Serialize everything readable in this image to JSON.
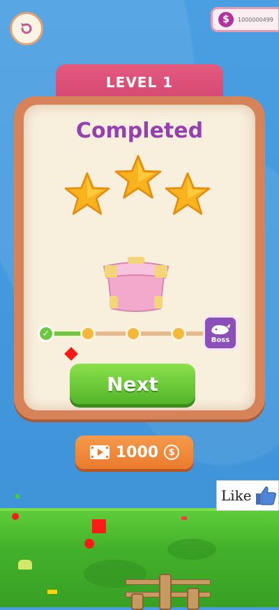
{
  "hud": {
    "restart_icon": "restart-icon",
    "coins": "1000000499",
    "coin_symbol": "$"
  },
  "level": {
    "title": "LEVEL 1"
  },
  "result": {
    "status": "Completed",
    "stars_earned": 3,
    "stars_total": 3
  },
  "progress": {
    "nodes_total": 4,
    "nodes_completed": 1,
    "boss_label": "Boss"
  },
  "buttons": {
    "next_label": "Next",
    "reward_amount": "1000",
    "reward_coin_symbol": "$"
  },
  "like": {
    "label": "Like"
  },
  "colors": {
    "title_purple": "#973fb0",
    "next_green": "#53b52a",
    "reward_orange": "#ea7a2e",
    "level_tab_pink": "#d54873"
  }
}
